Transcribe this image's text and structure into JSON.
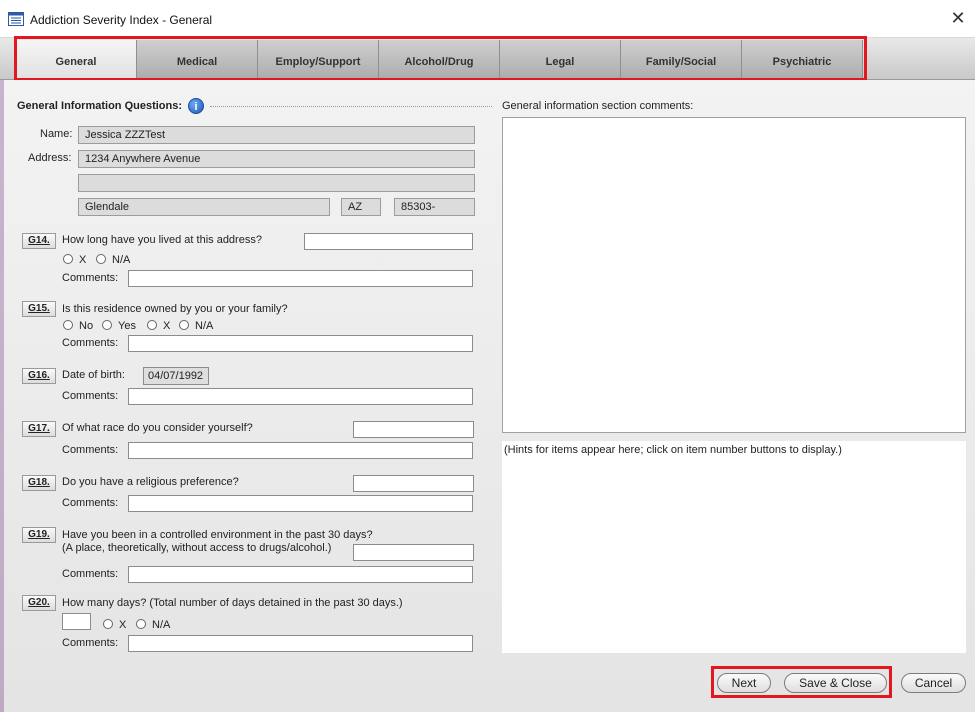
{
  "window": {
    "title": "Addiction Severity Index - General",
    "close_glyph": "✕"
  },
  "tabs": [
    {
      "label": "General",
      "active": true
    },
    {
      "label": "Medical"
    },
    {
      "label": "Employ/Support"
    },
    {
      "label": "Alcohol/Drug"
    },
    {
      "label": "Legal"
    },
    {
      "label": "Family/Social"
    },
    {
      "label": "Psychiatric"
    }
  ],
  "general_info": {
    "header": "General Information Questions:",
    "name_label": "Name:",
    "name": "Jessica ZZZTest",
    "address_label": "Address:",
    "address1": "1234 Anywhere Avenue",
    "address2": "",
    "city": "Glendale",
    "state": "AZ",
    "zip": "85303-"
  },
  "questions": {
    "g14": {
      "id": "G14.",
      "text": "How long have you lived at this address?",
      "opt_x": "X",
      "opt_na": "N/A"
    },
    "g15": {
      "id": "G15.",
      "text": "Is this residence owned by you or your family?",
      "opt_no": "No",
      "opt_yes": "Yes",
      "opt_x": "X",
      "opt_na": "N/A"
    },
    "g16": {
      "id": "G16.",
      "text": "Date of birth:",
      "value": "04/07/1992"
    },
    "g17": {
      "id": "G17.",
      "text": "Of what race do you consider yourself?"
    },
    "g18": {
      "id": "G18.",
      "text": "Do you have a religious preference?"
    },
    "g19": {
      "id": "G19.",
      "text": "Have you been in a controlled environment in the past 30 days?",
      "text2": "(A place, theoretically, without access to drugs/alcohol.)"
    },
    "g20": {
      "id": "G20.",
      "text": "How many days?  (Total number of days detained in the past 30 days.)",
      "opt_x": "X",
      "opt_na": "N/A"
    },
    "comments_label": "Comments:"
  },
  "right_panel": {
    "comments_label": "General information section comments:",
    "hint_text": "(Hints for items appear here; click on item number buttons to display.)"
  },
  "buttons": {
    "next": "Next",
    "save_close": "Save & Close",
    "cancel": "Cancel"
  }
}
